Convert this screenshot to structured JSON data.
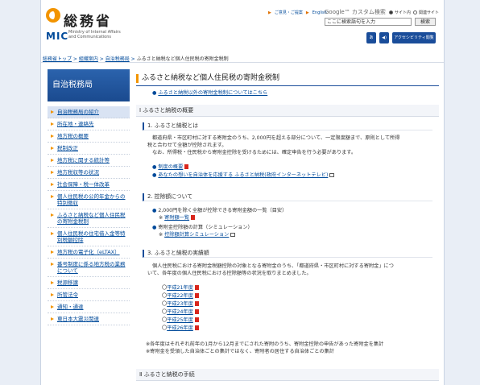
{
  "header": {
    "logo_jp": "総務省",
    "logo_mic": "MIC",
    "logo_en_line1": "Ministry of Internal Affairs",
    "logo_en_line2": "and Communications",
    "links": [
      "ご意見・ご提案",
      "English"
    ],
    "google_label": "Google™ カスタム検索",
    "radio_site": "サイト内",
    "radio_related": "関連サイト",
    "search_placeholder": "ここに検索語句を入力",
    "search_button": "検索",
    "tool_label": "アクセシビリティ閲覧支援ツール"
  },
  "breadcrumb": {
    "items": [
      "総務省トップ",
      "組織案内",
      "自治税務局"
    ],
    "current": "ふるさと納税など個人住民税の寄附金税制"
  },
  "sidebar": {
    "title": "自治税務局",
    "items": [
      "自治税務局の紹介",
      "所在地・連絡先",
      "地方税の概要",
      "税制改正",
      "地方税に関する統計等",
      "地方税収等の状況",
      "社会保障・税一体改革",
      "個人住民税の公的年金からの特別徴収",
      "ふるさと納税など個人住民税の寄附金税制",
      "個人住民税の住宅借入金等特別税額控除",
      "地方税の電子化（eLTAX）",
      "番号制度に係る地方税の業務について",
      "税源移譲",
      "所管法令",
      "通知・通達",
      "東日本大震災関連"
    ]
  },
  "main": {
    "title": "ふるさと納税など個人住民税の寄附金税制",
    "top_link": "ふるさと納税以外の寄附金税制についてはこちら",
    "sec1": "Ⅰ ふるさと納税の概要",
    "sub1": "1. ふるさと納税とは",
    "p1_line1": "都道府県・市区町村に対する寄附金のうち、2,000円を超える部分について、一定限度額まで、原則として所得",
    "p1_line2": "税と合わせて全額が控除されます。",
    "p1_line3": "なお、所得税・住民税から寄附金控除を受けるためには、確定申告を行う必要があります。",
    "link_overview": "制度の概要",
    "link_site": "あなたの想いを自治体を応援する ふるさと納税(政府インターネットテレビ)",
    "sub2": "2. 控除額について",
    "p2_line1": "2,000円を除く全額が控除できる寄附金額の一覧（目安）",
    "p2_note1": "※",
    "link_calc": "寄附額一覧",
    "p2_line2": "寄附金控除額の計算（シミュレーション）",
    "p2_note2": "※",
    "link_sim": "控除額計算シミュレーション",
    "sub3": "3. ふるさと納税の実績額",
    "p3_line1": "個人住民税における寄附金税額控除の対象となる寄附金のうち、「都道府県・市区町村に対する寄附金」につ",
    "p3_line2": "いて、各年度の個人住民税における控除額等の状況を取りまとめました。",
    "years": [
      "平成21年度",
      "平成22年度",
      "平成23年度",
      "平成24年度",
      "平成25年度",
      "平成26年度"
    ],
    "year_prefix": "〇",
    "note1": "※各年度はそれぞれ前年の1月から12月までにされた寄附のうち、寄附金控除の申告があった寄附金を集計",
    "note2": "※寄附金を受領した自治体ごとの集計ではなく、寄附者の居住する自治体ごとの集計",
    "sec2": "Ⅱ ふるさと納税の手続"
  },
  "colors": {
    "accent": "#f29400",
    "brand": "#1a4d9a",
    "link": "#004a9a"
  }
}
